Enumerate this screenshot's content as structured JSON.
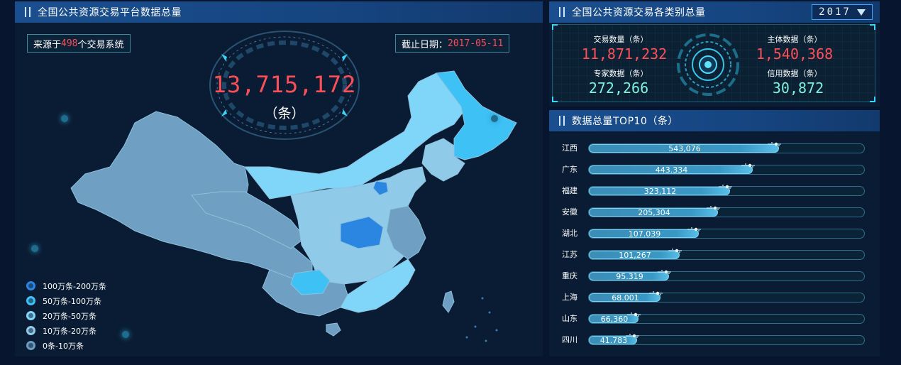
{
  "left_panel": {
    "title": "全国公共资源交易平台数据总量",
    "source_prefix": "来源于",
    "source_count": "498",
    "source_suffix": " 个交易系统",
    "date_label": "截止日期：",
    "date_value": "2017-05-11",
    "total_value": "13,715,172",
    "total_unit": "（条）",
    "legend": [
      {
        "label": "100万条-200万条",
        "color": "#2a86e0"
      },
      {
        "label": "50万条-100万条",
        "color": "#3ec1f5"
      },
      {
        "label": "20万条-50万条",
        "color": "#7fd6f8"
      },
      {
        "label": "10万条-20万条",
        "color": "#8fcbe8"
      },
      {
        "label": "0条-10万条",
        "color": "#6a9cc0"
      }
    ]
  },
  "right_top": {
    "title": "全国公共资源交易各类别总量",
    "year": "2017",
    "stats": [
      {
        "label": "交易数量（条）",
        "value": "11,871,232",
        "tone": "red"
      },
      {
        "label": "主体数据（条）",
        "value": "1,540,368",
        "tone": "red"
      },
      {
        "label": "专家数据（条）",
        "value": "272,266",
        "tone": "green"
      },
      {
        "label": "信用数据（条）",
        "value": "30,872",
        "tone": "green"
      }
    ]
  },
  "right_bottom": {
    "title": "数据总量TOP10（条）",
    "rows": [
      {
        "name": "江西",
        "value": "543,076",
        "fraction": 0.69
      },
      {
        "name": "广东",
        "value": "443.334",
        "fraction": 0.595
      },
      {
        "name": "福建",
        "value": "323,112",
        "fraction": 0.512
      },
      {
        "name": "安徽",
        "value": "205,304",
        "fraction": 0.47
      },
      {
        "name": "湖北",
        "value": "107.039",
        "fraction": 0.4
      },
      {
        "name": "江苏",
        "value": "101,267",
        "fraction": 0.33
      },
      {
        "name": "重庆",
        "value": "95.319",
        "fraction": 0.29
      },
      {
        "name": "上海",
        "value": "68.001",
        "fraction": 0.26
      },
      {
        "name": "山东",
        "value": "66,360",
        "fraction": 0.18
      },
      {
        "name": "四川",
        "value": "41.783",
        "fraction": 0.175
      }
    ]
  }
}
